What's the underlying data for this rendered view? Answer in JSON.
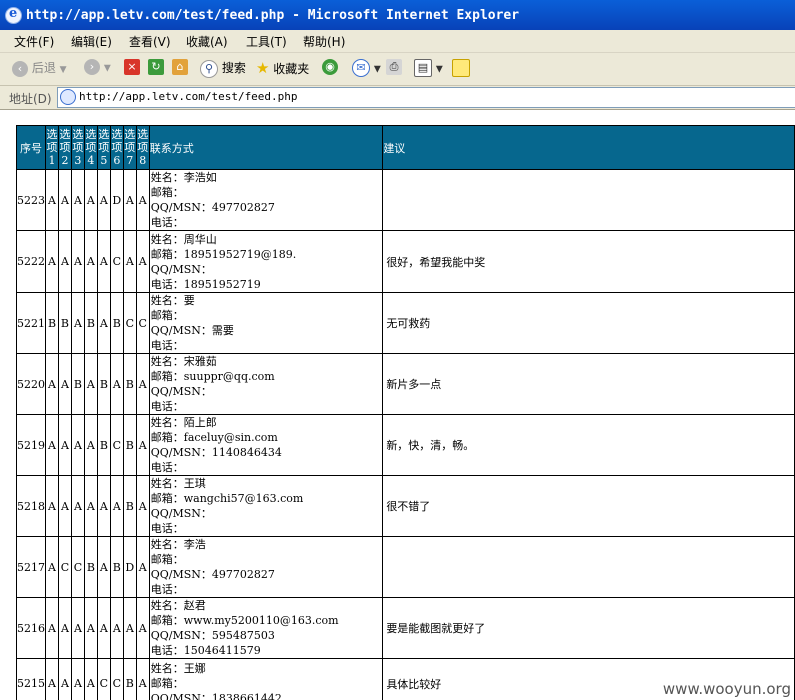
{
  "window": {
    "title": "http://app.letv.com/test/feed.php - Microsoft Internet Explorer"
  },
  "menu": [
    {
      "label": "文件(F)"
    },
    {
      "label": "编辑(E)"
    },
    {
      "label": "查看(V)"
    },
    {
      "label": "收藏(A)"
    },
    {
      "label": "工具(T)"
    },
    {
      "label": "帮助(H)"
    }
  ],
  "toolbar": {
    "back_label": "后退",
    "search_label": "搜索",
    "favorites_label": "收藏夹"
  },
  "address": {
    "label": "地址(D)",
    "url": "http://app.letv.com/test/feed.php"
  },
  "table": {
    "headers": {
      "num": "序号",
      "options": [
        "选项1",
        "选项2",
        "选项3",
        "选项4",
        "选项5",
        "选项6",
        "选项7",
        "选项8"
      ],
      "contact": "联系方式",
      "suggestion": "建议"
    },
    "rows": [
      {
        "id": "5223",
        "options": [
          "A",
          "A",
          "A",
          "A",
          "A",
          "D",
          "A",
          "A"
        ],
        "contact": [
          "姓名：李浩如",
          "邮箱：",
          "QQ/MSN：497702827",
          "电话："
        ],
        "suggestion": ""
      },
      {
        "id": "5222",
        "options": [
          "A",
          "A",
          "A",
          "A",
          "A",
          "C",
          "A",
          "A"
        ],
        "contact": [
          "姓名：周华山",
          "邮箱：18951952719@189.",
          "QQ/MSN：",
          "电话：18951952719"
        ],
        "suggestion": "很好，希望我能中奖"
      },
      {
        "id": "5221",
        "options": [
          "B",
          "B",
          "A",
          "B",
          "A",
          "B",
          "C",
          "C"
        ],
        "contact": [
          "姓名：要",
          "邮箱：",
          "QQ/MSN：需要",
          "电话："
        ],
        "suggestion": "无可救药"
      },
      {
        "id": "5220",
        "options": [
          "A",
          "A",
          "B",
          "A",
          "B",
          "A",
          "B",
          "A"
        ],
        "contact": [
          "姓名：宋雅茹",
          "邮箱：suuppr@qq.com",
          "QQ/MSN：",
          "电话："
        ],
        "suggestion": "新片多一点"
      },
      {
        "id": "5219",
        "options": [
          "A",
          "A",
          "A",
          "A",
          "B",
          "C",
          "B",
          "A"
        ],
        "contact": [
          "姓名：陌上郎",
          "邮箱：faceluy@sin.com",
          "QQ/MSN：1140846434",
          "电话："
        ],
        "suggestion": "新，快，清，畅。"
      },
      {
        "id": "5218",
        "options": [
          "A",
          "A",
          "A",
          "A",
          "A",
          "A",
          "B",
          "A"
        ],
        "contact": [
          "姓名：王琪",
          "邮箱：wangchi57@163.com",
          "QQ/MSN：",
          "电话："
        ],
        "suggestion": "很不错了"
      },
      {
        "id": "5217",
        "options": [
          "A",
          "C",
          "C",
          "B",
          "A",
          "B",
          "D",
          "A"
        ],
        "contact": [
          "姓名：李浩",
          "邮箱：",
          "QQ/MSN：497702827",
          "电话："
        ],
        "suggestion": ""
      },
      {
        "id": "5216",
        "options": [
          "A",
          "A",
          "A",
          "A",
          "A",
          "A",
          "A",
          "A"
        ],
        "contact": [
          "姓名：赵君",
          "邮箱：www.my5200110@163.com",
          "QQ/MSN：595487503",
          "电话：15046411579"
        ],
        "suggestion": "要是能截图就更好了"
      },
      {
        "id": "5215",
        "options": [
          "A",
          "A",
          "A",
          "A",
          "C",
          "C",
          "B",
          "A"
        ],
        "contact": [
          "姓名：王娜",
          "邮箱：",
          "QQ/MSN：1838661442",
          ""
        ],
        "suggestion": "具体比较好"
      }
    ]
  },
  "watermark": "www.wooyun.org"
}
